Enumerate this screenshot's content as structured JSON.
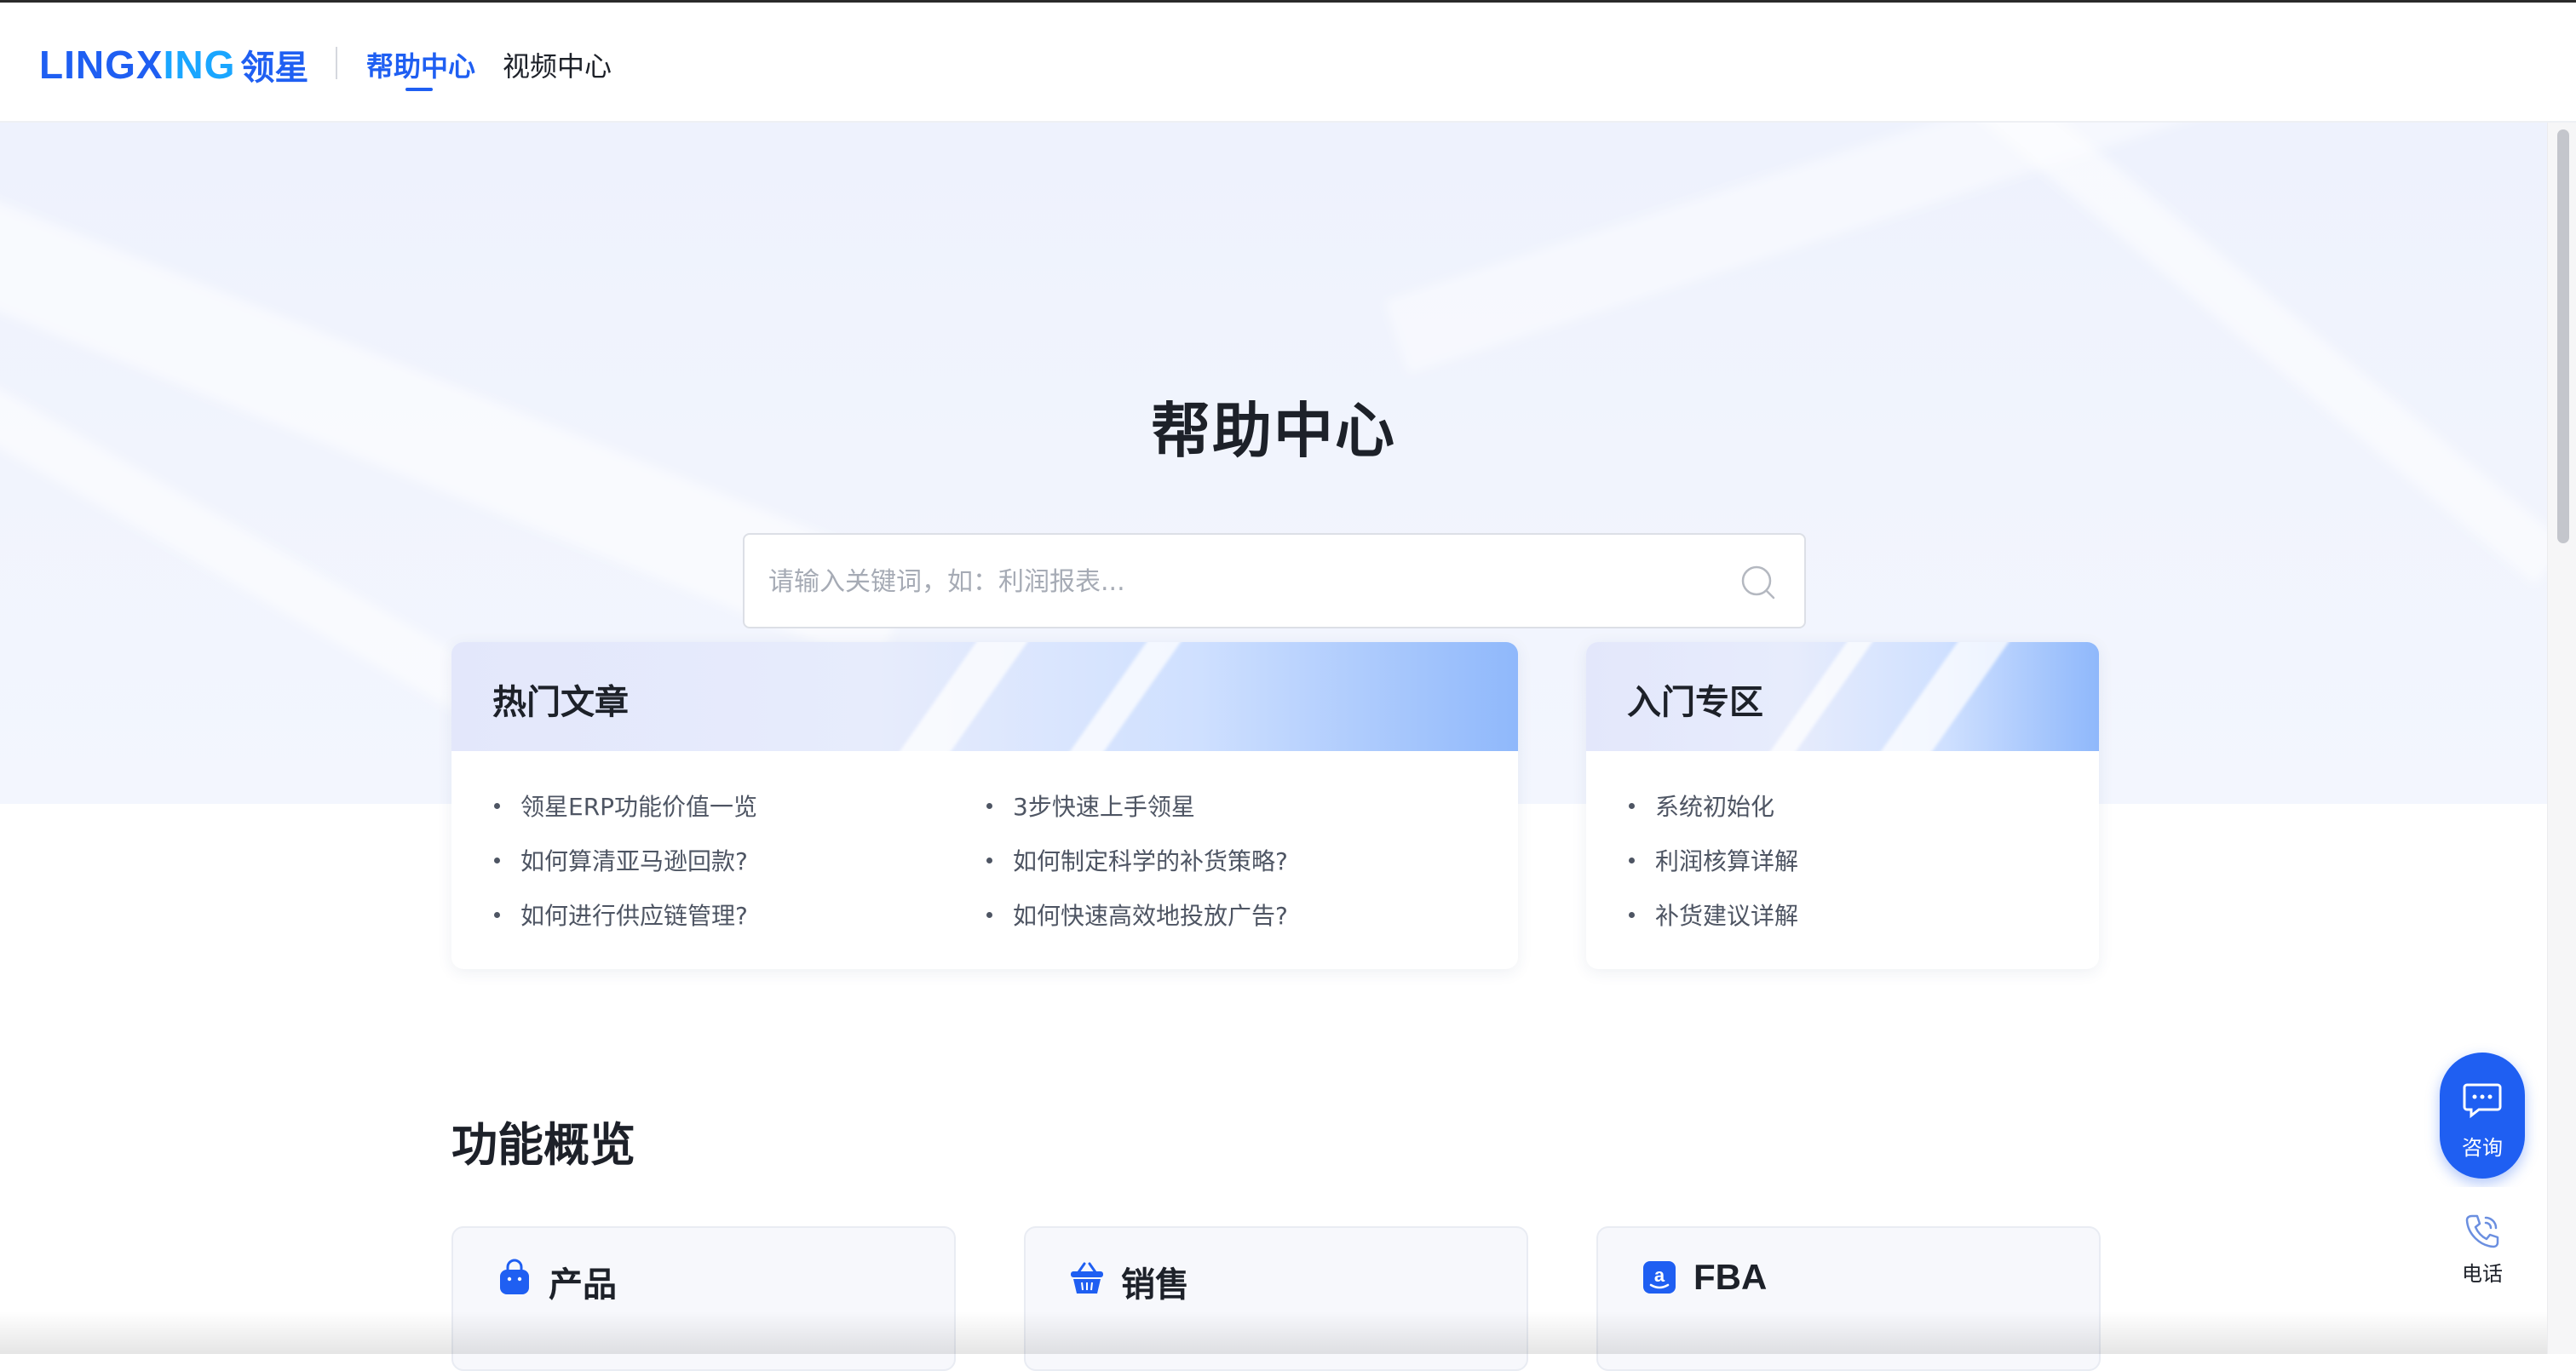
{
  "header": {
    "logo_latin_a": "LINGX",
    "logo_latin_b": "ING",
    "logo_cn": "领星",
    "nav": [
      {
        "label": "帮助中心",
        "active": true
      },
      {
        "label": "视频中心",
        "active": false
      }
    ]
  },
  "hero": {
    "title": "帮助中心",
    "search_placeholder": "请输入关键词，如：利润报表..."
  },
  "hot_articles": {
    "title": "热门文章",
    "left": [
      "领星ERP功能价值一览",
      "如何算清亚马逊回款?",
      "如何进行供应链管理?"
    ],
    "right": [
      "3步快速上手领星",
      "如何制定科学的补货策略?",
      "如何快速高效地投放广告?"
    ]
  },
  "getting_started": {
    "title": "入门专区",
    "items": [
      "系统初始化",
      "利润核算详解",
      "补货建议详解"
    ]
  },
  "features": {
    "title": "功能概览",
    "cards": [
      {
        "label": "产品",
        "icon": "shopping-bag-icon"
      },
      {
        "label": "销售",
        "icon": "basket-icon"
      },
      {
        "label": "FBA",
        "icon": "amazon-icon"
      }
    ]
  },
  "float": {
    "consult_label": "咨询",
    "phone_label": "电话"
  },
  "colors": {
    "accent": "#1f5ff2",
    "logo_accent_2": "#1aa6ff",
    "text": "#1d2129"
  }
}
